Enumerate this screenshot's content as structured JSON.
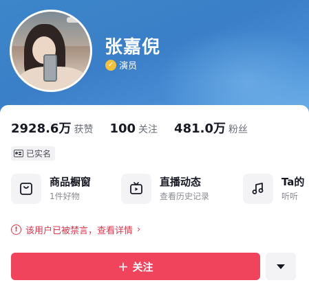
{
  "profile": {
    "name": "张嘉倪",
    "verify_label": "演员"
  },
  "stats": [
    {
      "value": "2928.6万",
      "label": "获赞"
    },
    {
      "value": "100",
      "label": "关注"
    },
    {
      "value": "481.0万",
      "label": "粉丝"
    }
  ],
  "realname_badge": "已实名",
  "features": [
    {
      "title": "商品橱窗",
      "subtitle": "1件好物",
      "icon": "shopping-bag-icon"
    },
    {
      "title": "直播动态",
      "subtitle": "查看历史记录",
      "icon": "tv-icon"
    },
    {
      "title": "Ta的",
      "subtitle": "听听",
      "icon": "music-note-icon"
    }
  ],
  "notice": {
    "text": "该用户已被禁言，查看详情",
    "chevron": "›",
    "color": "#e0344b"
  },
  "actions": {
    "follow_label": "关注",
    "follow_plus": "＋",
    "follow_color": "#f0435c"
  }
}
